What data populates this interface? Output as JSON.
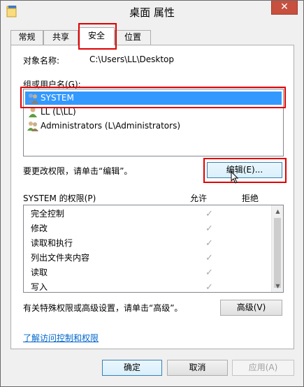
{
  "window": {
    "title": "桌面 属性",
    "close_label": "✕"
  },
  "tabs": [
    {
      "label": "常规",
      "active": false
    },
    {
      "label": "共享",
      "active": false
    },
    {
      "label": "安全",
      "active": true
    },
    {
      "label": "位置",
      "active": false
    }
  ],
  "security": {
    "object_label": "对象名称:",
    "object_value": "C:\\Users\\LL\\Desktop",
    "group_label": "组或用户名(G):",
    "users": [
      {
        "name": "SYSTEM",
        "icon": "users-group-icon",
        "selected": true
      },
      {
        "name": "LL (L\\LL)",
        "icon": "user-icon",
        "selected": false
      },
      {
        "name": "Administrators (L\\Administrators)",
        "icon": "users-group-icon",
        "selected": false
      }
    ],
    "change_hint": "要更改权限，请单击“编辑”。",
    "edit_button": "编辑(E)...",
    "perm_header": "SYSTEM 的权限(P)",
    "allow_header": "允许",
    "deny_header": "拒绝",
    "permissions": [
      {
        "name": "完全控制",
        "allow": "✓"
      },
      {
        "name": "修改",
        "allow": "✓"
      },
      {
        "name": "读取和执行",
        "allow": "✓"
      },
      {
        "name": "列出文件夹内容",
        "allow": "✓"
      },
      {
        "name": "读取",
        "allow": "✓"
      },
      {
        "name": "写入",
        "allow": "✓"
      }
    ],
    "advanced_hint": "有关特殊权限或高级设置，请单击“高级”。",
    "advanced_button": "高级(V)",
    "learn_link": "了解访问控制和权限"
  },
  "footer": {
    "ok": "确定",
    "cancel": "取消",
    "apply": "应用(A)"
  }
}
